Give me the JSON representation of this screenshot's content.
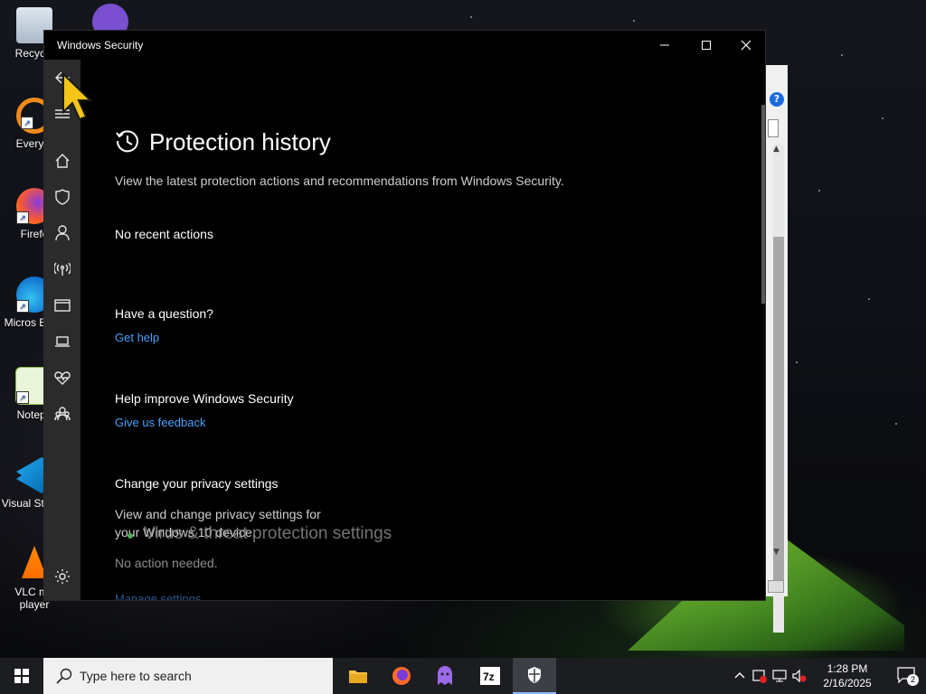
{
  "desktop": {
    "icons": [
      {
        "label": "Recycle",
        "icon": "recycle-bin-icon"
      },
      {
        "label": "Everyth",
        "icon": "everything-icon"
      },
      {
        "label": "Firefo",
        "icon": "firefox-icon"
      },
      {
        "label": "Micros Edge",
        "icon": "edge-icon"
      },
      {
        "label": "Notepa",
        "icon": "notepad-plus-icon"
      },
      {
        "label": "Visual St Cod",
        "icon": "vscode-icon"
      },
      {
        "label": "VLC me player",
        "icon": "vlc-icon"
      }
    ]
  },
  "window": {
    "title": "Windows Security",
    "controls": {
      "minimize": "—",
      "maximize": "☐",
      "close": "✕"
    }
  },
  "nav": {
    "items": [
      "back-icon",
      "hamburger-icon",
      "home-icon",
      "shield-icon",
      "account-icon",
      "firewall-icon",
      "app-browser-icon",
      "device-icon",
      "health-icon",
      "family-icon",
      "settings-icon"
    ]
  },
  "page": {
    "title": "Protection history",
    "description": "View the latest protection actions and recommendations from Windows Security.",
    "no_actions": "No recent actions",
    "question_heading": "Have a question?",
    "get_help": "Get help",
    "improve_heading": "Help improve Windows Security",
    "feedback": "Give us feedback",
    "privacy_heading": "Change your privacy settings",
    "privacy_desc": "View and change privacy settings for your Windows 10 device.",
    "ghost_heading": "Virus & threat protection settings",
    "no_action_needed": "No action needed.",
    "manage_settings": "Manage settings"
  },
  "taskbar": {
    "search_placeholder": "Type here to search",
    "apps": [
      "file-explorer-icon",
      "firefox-icon",
      "tor-icon",
      "7zip-icon",
      "windows-security-icon"
    ],
    "time": "1:28 PM",
    "date": "2/16/2025",
    "notifications": "2"
  }
}
